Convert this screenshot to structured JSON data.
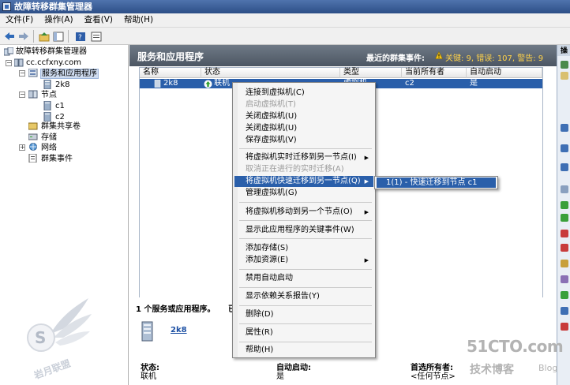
{
  "window": {
    "title": "故障转移群集管理器"
  },
  "menubar": {
    "items": [
      "文件(F)",
      "操作(A)",
      "查看(V)",
      "帮助(H)"
    ]
  },
  "toolbar": {
    "icons": [
      "back-arrow-icon",
      "forward-arrow-icon",
      "up-folder-icon",
      "show-hide-tree-icon",
      "help-icon",
      "properties-icon"
    ]
  },
  "tree": {
    "root": "故障转移群集管理器",
    "cluster": "cc.ccfxny.com",
    "services_apps": "服务和应用程序",
    "vm_2k8": "2k8",
    "nodes": "节点",
    "node_c1": "c1",
    "node_c2": "c2",
    "shared_volumes": "群集共享卷",
    "storage": "存储",
    "networks": "网络",
    "cluster_events": "群集事件"
  },
  "main": {
    "title": "服务和应用程序",
    "events_label": "最近的群集事件:",
    "events_summary": "关键: 9, 错误: 107, 警告: 9",
    "columns": [
      "名称",
      "状态",
      "类型",
      "当前所有者",
      "自动启动"
    ],
    "row": {
      "name": "2k8",
      "status": "联机",
      "type": "虚拟机",
      "owner": "c2",
      "autostart": "是"
    },
    "summary_line": "1 个服务或应用程序。",
    "summary_trailing": "已",
    "summary_name": "2k8",
    "details": {
      "status_label": "状态:",
      "status_value": "联机",
      "autostart_label": "自动启动:",
      "autostart_value": "是",
      "preferred_label": "首选所有者:",
      "preferred_value": "<任何节点>"
    }
  },
  "actions": {
    "header": "操"
  },
  "context_menu": {
    "connect": "连接到虚拟机(C)",
    "start": "启动虚拟机(T)",
    "shutdown": "关闭虚拟机(U)",
    "turn_off": "关闭虚拟机(U)",
    "save": "保存虚拟机(V)",
    "live_migrate": "将虚拟机实时迁移到另一节点(I)",
    "cancel_live": "取消正在进行的实时迁移(A)",
    "quick_migrate": "将虚拟机快速迁移到另一节点(Q)",
    "manage": "管理虚拟机(G)",
    "move_vm": "将虚拟机移动到另一个节点(O)",
    "show_events": "显示此应用程序的关键事件(W)",
    "add_storage": "添加存储(S)",
    "add_resource": "添加资源(E)",
    "disable_autostart": "禁用自动启动",
    "dependency_report": "显示依赖关系报告(Y)",
    "delete": "删除(D)",
    "properties": "属性(R)",
    "help": "帮助(H)"
  },
  "submenu": {
    "quick_migrate_target": "1(1) - 快速迁移到节点 c1"
  },
  "watermark": {
    "site": "51CTO.com",
    "sub": "技术博客",
    "blog": "Blog"
  },
  "colors": {
    "selection": "#2a5faa",
    "header": "#5b6571",
    "titlebar": "#3a5f99"
  }
}
